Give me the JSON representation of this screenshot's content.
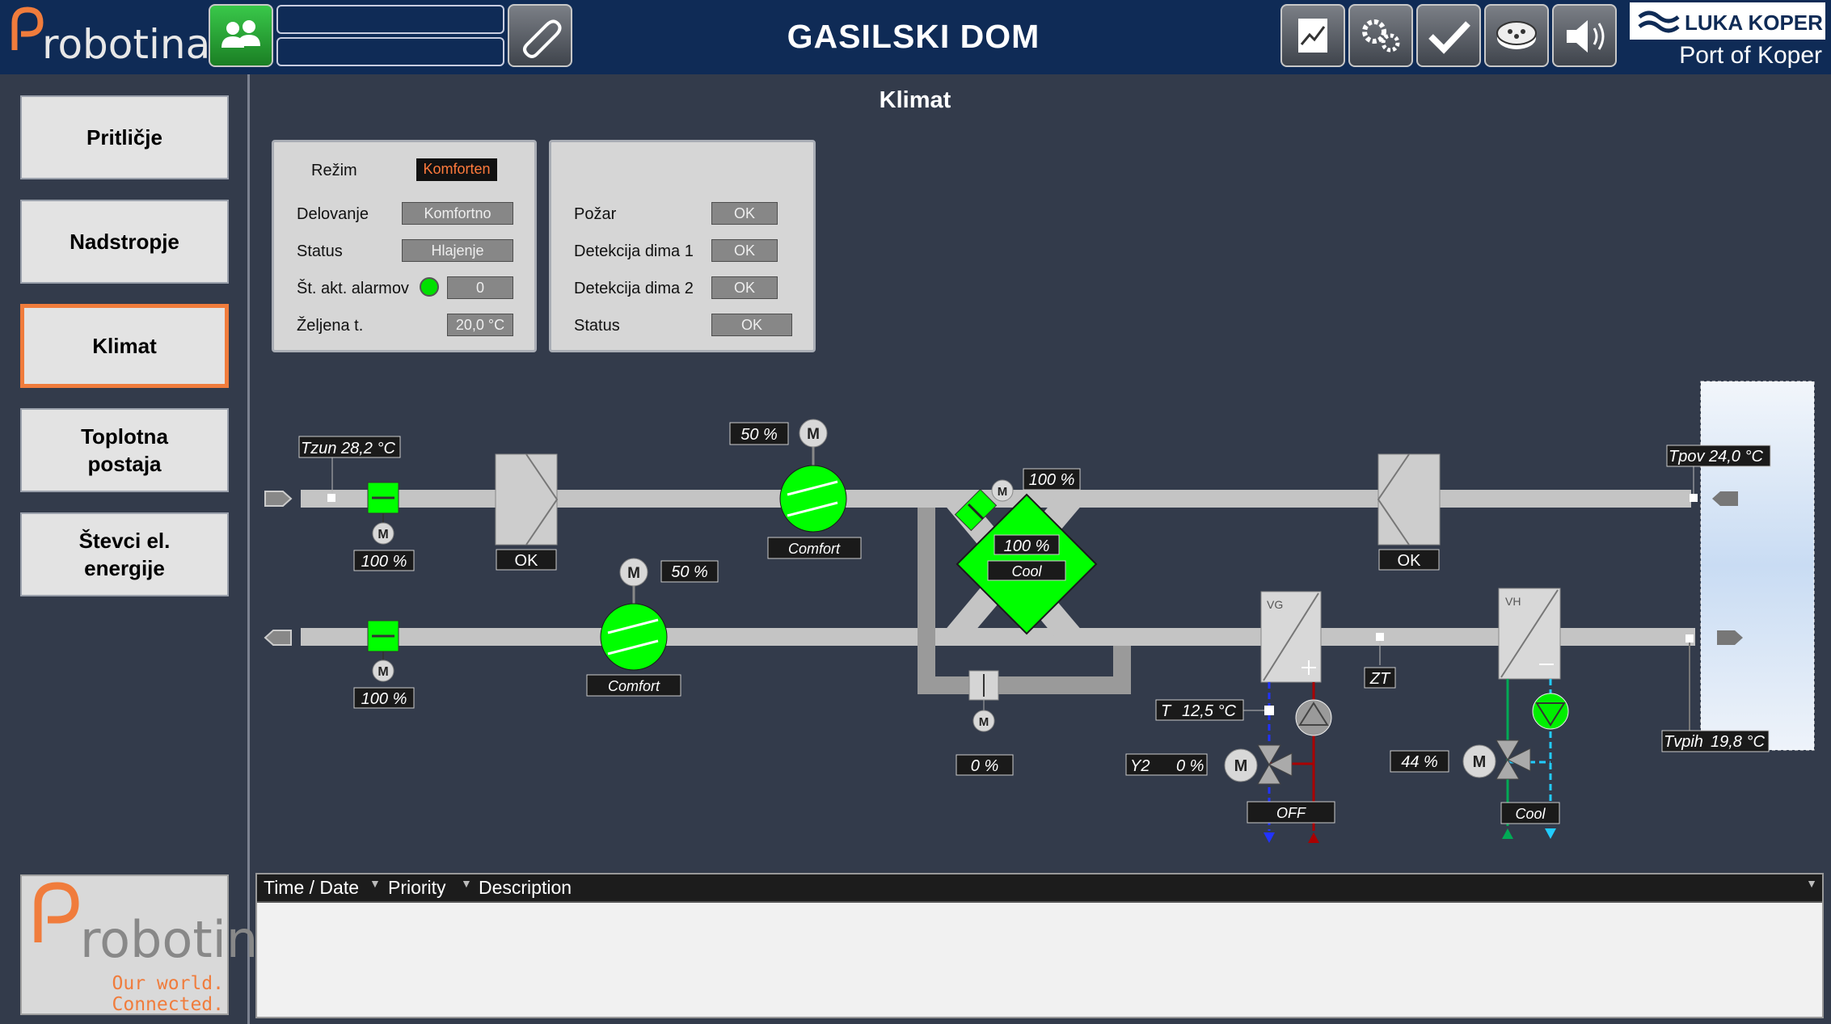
{
  "header": {
    "logo_text": "robotina",
    "title": "GASILSKI DOM",
    "brand_name": "LUKA KOPER",
    "brand_sub": "Port of Koper",
    "buttons": [
      "users-icon",
      "attachment-icon",
      "trend-chart-icon",
      "settings-icon",
      "check-icon",
      "film-reel-icon",
      "speaker-icon"
    ]
  },
  "nav": {
    "items": [
      {
        "label": "Pritličje"
      },
      {
        "label": "Nadstropje"
      },
      {
        "label": "Klimat",
        "active": true
      },
      {
        "label": "Toplotna postaja"
      },
      {
        "label": "Števci el. energije"
      }
    ]
  },
  "page": {
    "title": "Klimat"
  },
  "status_panel": {
    "rezim_label": "Režim",
    "rezim_value": "Komforten",
    "rows": [
      {
        "label": "Delovanje",
        "value": "Komfortno"
      },
      {
        "label": "Status",
        "value": "Hlajenje"
      },
      {
        "label": "Št. akt. alarmov",
        "value": "0"
      },
      {
        "label": "Željena t.",
        "value": "20,0 °C"
      }
    ]
  },
  "safety_panel": {
    "rows": [
      {
        "label": "Požar",
        "value": "OK"
      },
      {
        "label": "Detekcija dima 1",
        "value": "OK"
      },
      {
        "label": "Detekcija dima 2",
        "value": "OK"
      },
      {
        "label": "Status",
        "value": "OK"
      }
    ]
  },
  "diagram": {
    "tzun_label": "Tzun",
    "tzun_value": "28,2 °C",
    "tpov_label": "Tpov",
    "tpov_value": "24,0 °C",
    "tvpih_label": "Tvpih",
    "tvpih_value": "19,8 °C",
    "damper_supply_pct": "100 %",
    "damper_exhaust_pct": "100 %",
    "filter_supply_status": "OK",
    "filter_return_status": "OK",
    "fan_supply_pct": "50 %",
    "fan_supply_mode": "Comfort",
    "fan_exhaust_pct": "50 %",
    "fan_exhaust_mode": "Comfort",
    "motor_label": "M",
    "hrv_damper_pct": "100 %",
    "hrv_pct": "100 %",
    "hrv_mode": "Cool",
    "bypass_pct": "0 %",
    "vg_label": "VG",
    "vh_label": "VH",
    "zt_label": "ZT",
    "vg_t_label": "T",
    "vg_t_value": "12,5 °C",
    "vg_y2_label": "Y2",
    "vg_y2_value": "0 %",
    "vg_mode": "OFF",
    "vh_valve_pct": "44 %",
    "vh_mode": "Cool"
  },
  "alarm_table": {
    "columns": [
      "Time / Date",
      "Priority",
      "Description"
    ],
    "rows": []
  },
  "bottom_logo": {
    "text": "robotina",
    "tagline_1": "Our world.",
    "tagline_2": "Connected."
  },
  "colors": {
    "accent": "#f07c3c",
    "active_green": "#00ff00",
    "header": "#0f2b56",
    "background": "#333b4b"
  }
}
